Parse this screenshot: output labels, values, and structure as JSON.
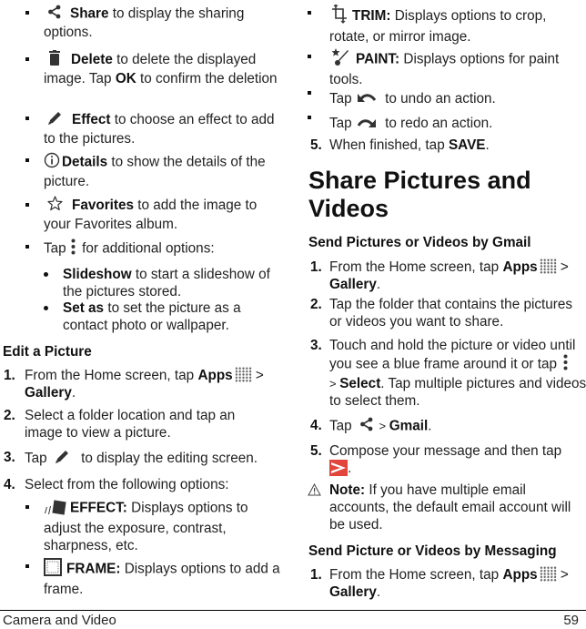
{
  "left_column": {
    "gallery_options": [
      {
        "icon": "share-icon",
        "label": "Share",
        "text": " to display the sharing options."
      },
      {
        "icon": "trash-icon",
        "label": "Delete",
        "text_before_ok": " to delete the displayed image. Tap ",
        "ok": "OK",
        "text_after_ok": " to confirm the deletion"
      },
      {
        "icon": "pencil-icon",
        "label": "Effect",
        "text": " to choose an effect to add to the pictures."
      },
      {
        "icon": "info-icon",
        "label": "Details",
        "text": " to show the details of the picture."
      },
      {
        "icon": "star-outline-icon",
        "label": "Favorites",
        "text": " to add the image to your Favorites album."
      }
    ],
    "more_options": {
      "prefix": "Tap ",
      "icon": "more-vertical-icon",
      "suffix": " for additional options:",
      "sub_items": [
        {
          "label": "Slideshow",
          "text": " to start a slideshow of the pictures stored."
        },
        {
          "label": "Set as",
          "text": " to set the picture as a contact photo or wallpaper."
        }
      ]
    },
    "edit_section": {
      "heading": "Edit a Picture",
      "steps": [
        {
          "num": "1.",
          "text1": "From the Home screen, tap ",
          "bold1": "Apps",
          "sep": " > ",
          "bold2": "Gallery",
          "end": "."
        },
        {
          "num": "2.",
          "text": "Select a folder location and tap an image to view a picture."
        },
        {
          "num": "3.",
          "prefix": "Tap ",
          "icon": "pencil-icon",
          "suffix": " to display the editing screen."
        },
        {
          "num": "4.",
          "text": "Select from the following options:"
        }
      ],
      "options": [
        {
          "icon": "effect-cards-icon",
          "label": "EFFECT:",
          "text": " Displays options to adjust the exposure, contrast, sharpness, etc."
        },
        {
          "icon": "frame-icon",
          "label": "FRAME:",
          "text": " Displays options to add a frame."
        }
      ]
    }
  },
  "right_column": {
    "edit_options_continued": [
      {
        "icon": "crop-icon",
        "label": "TRIM:",
        "text": " Displays options to crop, rotate, or mirror image."
      },
      {
        "icon": "paint-icon",
        "label": "PAINT:",
        "text": " Displays options for paint tools."
      }
    ],
    "undo": {
      "prefix": "Tap ",
      "icon": "undo-icon",
      "suffix": " to undo an action."
    },
    "redo": {
      "prefix": "Tap ",
      "icon": "redo-icon",
      "suffix": " to redo an action."
    },
    "step5": {
      "num": "5.",
      "text": "When finished, tap ",
      "bold": "SAVE",
      "end": "."
    },
    "share_section": {
      "title": "Share Pictures and Videos",
      "gmail_heading": "Send Pictures or Videos by Gmail",
      "gmail_steps": [
        {
          "num": "1.",
          "text1": "From the Home screen, tap ",
          "bold1": "Apps",
          "sep": " > ",
          "bold2": "Gallery",
          "end": "."
        },
        {
          "num": "2.",
          "text": "Tap the folder that contains the pictures or videos you want to share."
        },
        {
          "num": "3.",
          "text1": "Touch and hold the picture or video until you see a blue frame around it or tap ",
          "sep": " > ",
          "bold": "Select",
          "text2": ". Tap multiple pictures and videos to select them."
        },
        {
          "num": "4.",
          "prefix": "Tap ",
          "sep": " > ",
          "bold": "Gmail",
          "end": "."
        },
        {
          "num": "5.",
          "text": "Compose your message and then tap ",
          "end": "."
        }
      ],
      "note": {
        "label": "Note:",
        "text": " If you have multiple email accounts, the default email account will be used."
      },
      "messaging_heading": "Send Picture or Videos by Messaging",
      "messaging_steps": [
        {
          "num": "1.",
          "text1": "From the Home screen, tap ",
          "bold1": "Apps",
          "sep": " > ",
          "bold2": "Gallery",
          "end": "."
        }
      ]
    }
  },
  "footer": {
    "section": "Camera and Video",
    "page": "59"
  },
  "colors": {
    "send_button": "#e2453c",
    "icon_gray": "#333333"
  }
}
